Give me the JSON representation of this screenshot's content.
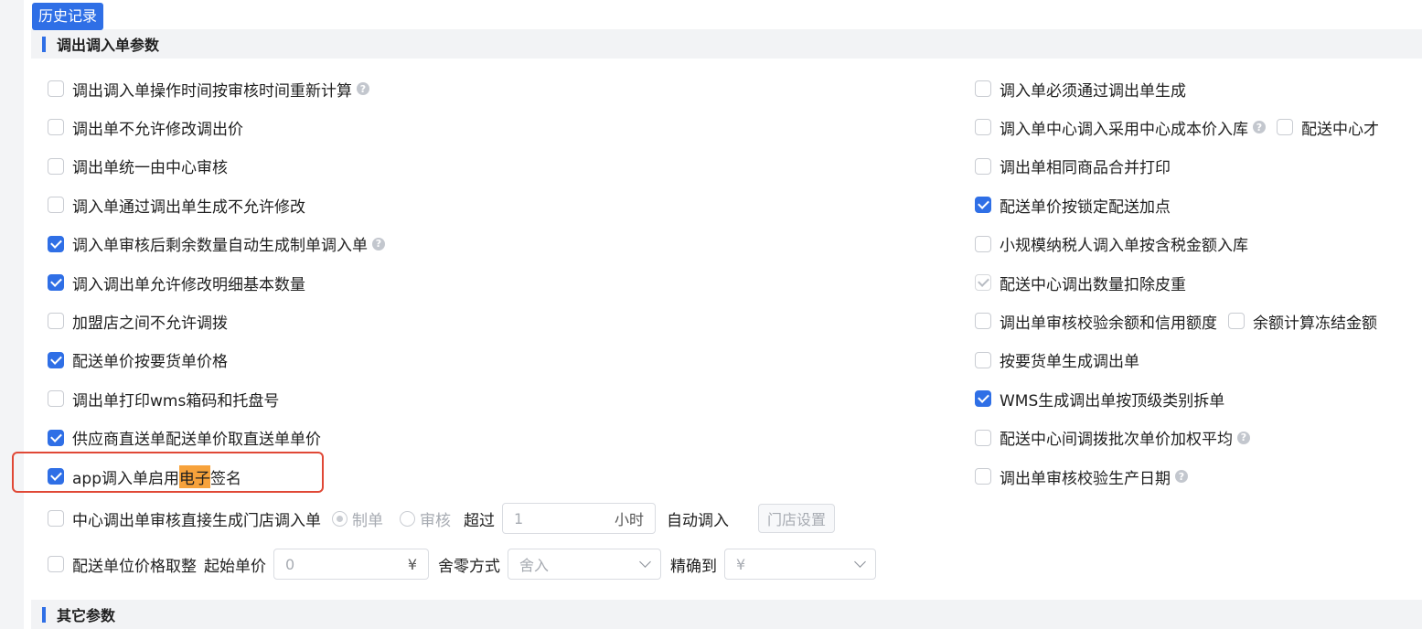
{
  "history_button": "历史记录",
  "sections": {
    "transfer": "调出调入单参数",
    "other": "其它参数"
  },
  "left_options": [
    {
      "label": "调出调入单操作时间按审核时间重新计算",
      "checked": false,
      "help": true
    },
    {
      "label": "调出单不允许修改调出价",
      "checked": false
    },
    {
      "label": "调出单统一由中心审核",
      "checked": false
    },
    {
      "label": "调入单通过调出单生成不允许修改",
      "checked": false
    },
    {
      "label": "调入单审核后剩余数量自动生成制单调入单",
      "checked": true,
      "help": true
    },
    {
      "label": "调入调出单允许修改明细基本数量",
      "checked": true
    },
    {
      "label": "加盟店之间不允许调拨",
      "checked": false
    },
    {
      "label": "配送单价按要货单价格",
      "checked": true
    },
    {
      "label": "调出单打印wms箱码和托盘号",
      "checked": false
    },
    {
      "label": "供应商直送单配送单价取直送单单价",
      "checked": true
    }
  ],
  "esign": {
    "pre": "app调入单启用",
    "highlight": "电子",
    "post": "签名",
    "checked": true
  },
  "right_options": [
    {
      "label": "调入单必须通过调出单生成",
      "checked": false
    },
    {
      "label": "调入单中心调入采用中心成本价入库",
      "checked": false,
      "help": true,
      "extra": "配送中心才"
    },
    {
      "label": "调出单相同商品合并打印",
      "checked": false
    },
    {
      "label": "配送单价按锁定配送加点",
      "checked": true
    },
    {
      "label": "小规模纳税人调入单按含税金额入库",
      "checked": false
    },
    {
      "label": "配送中心调出数量扣除皮重",
      "checked": true,
      "disabled": true
    },
    {
      "label": "调出单审核校验余额和信用额度",
      "checked": false,
      "extra": "余额计算冻结金额"
    },
    {
      "label": "按要货单生成调出单",
      "checked": false
    },
    {
      "label": "WMS生成调出单按顶级类别拆单",
      "checked": true
    },
    {
      "label": "配送中心间调拨批次单价加权平均",
      "checked": false,
      "help": true
    },
    {
      "label": "调出单审核校验生产日期",
      "checked": false,
      "help": true
    }
  ],
  "auto_row": {
    "label": "中心调出单审核直接生成门店调入单",
    "radio_make": "制单",
    "radio_audit": "审核",
    "exceed": "超过",
    "hours_value": "1",
    "hours_unit": "小时",
    "auto_in": "自动调入",
    "store_settings": "门店设置"
  },
  "round_row": {
    "label": "配送单位价格取整",
    "start_price": "起始单价",
    "start_value": "0",
    "currency": "¥",
    "round_mode": "舍零方式",
    "round_value": "舍入",
    "precision": "精确到",
    "precision_value": "¥"
  },
  "help_mark": "?"
}
